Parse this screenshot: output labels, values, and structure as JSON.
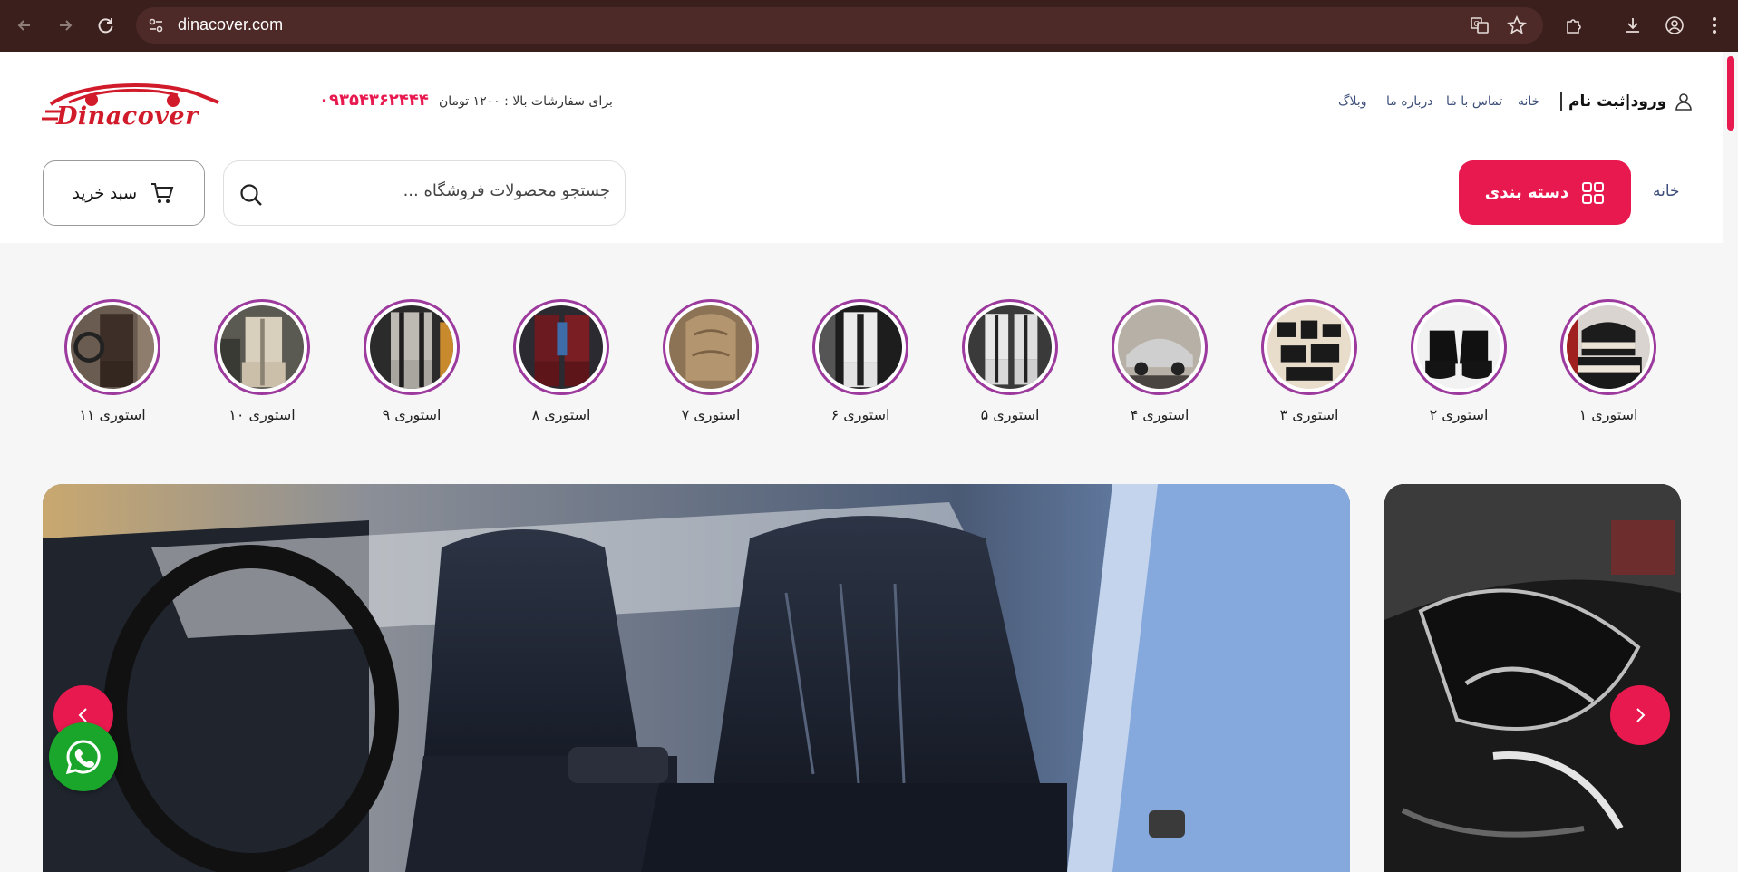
{
  "browser": {
    "url": "dinacover.com"
  },
  "header": {
    "logo_text": "Dinacover",
    "order_info": "برای سفارشات بالا : ۱۲۰۰ تومان",
    "phone": "۰۹۳۵۴۳۶۲۴۴۴",
    "login_label": "ورود|ثبت نام",
    "links": {
      "home": "خانه",
      "contact": "تماس با ما",
      "about": "درباره ما",
      "blog": "وبلاگ"
    },
    "category_button": "دسته بندی",
    "breadcrumb_home": "خانه",
    "search_placeholder": "جستجو محصولات فروشگاه ...",
    "cart_label": "سبد خرید"
  },
  "stories": [
    {
      "label": "استوری ۱"
    },
    {
      "label": "استوری ۲"
    },
    {
      "label": "استوری ۳"
    },
    {
      "label": "استوری ۴"
    },
    {
      "label": "استوری ۵"
    },
    {
      "label": "استوری ۶"
    },
    {
      "label": "استوری ۷"
    },
    {
      "label": "استوری ۸"
    },
    {
      "label": "استوری ۹"
    },
    {
      "label": "استوری ۱۰"
    },
    {
      "label": "استوری ۱۱"
    }
  ],
  "colors": {
    "accent": "#e8194f",
    "story_ring": "#9c3a9e",
    "whatsapp": "#1aa62a",
    "browser_bar": "#3a1f1c"
  }
}
